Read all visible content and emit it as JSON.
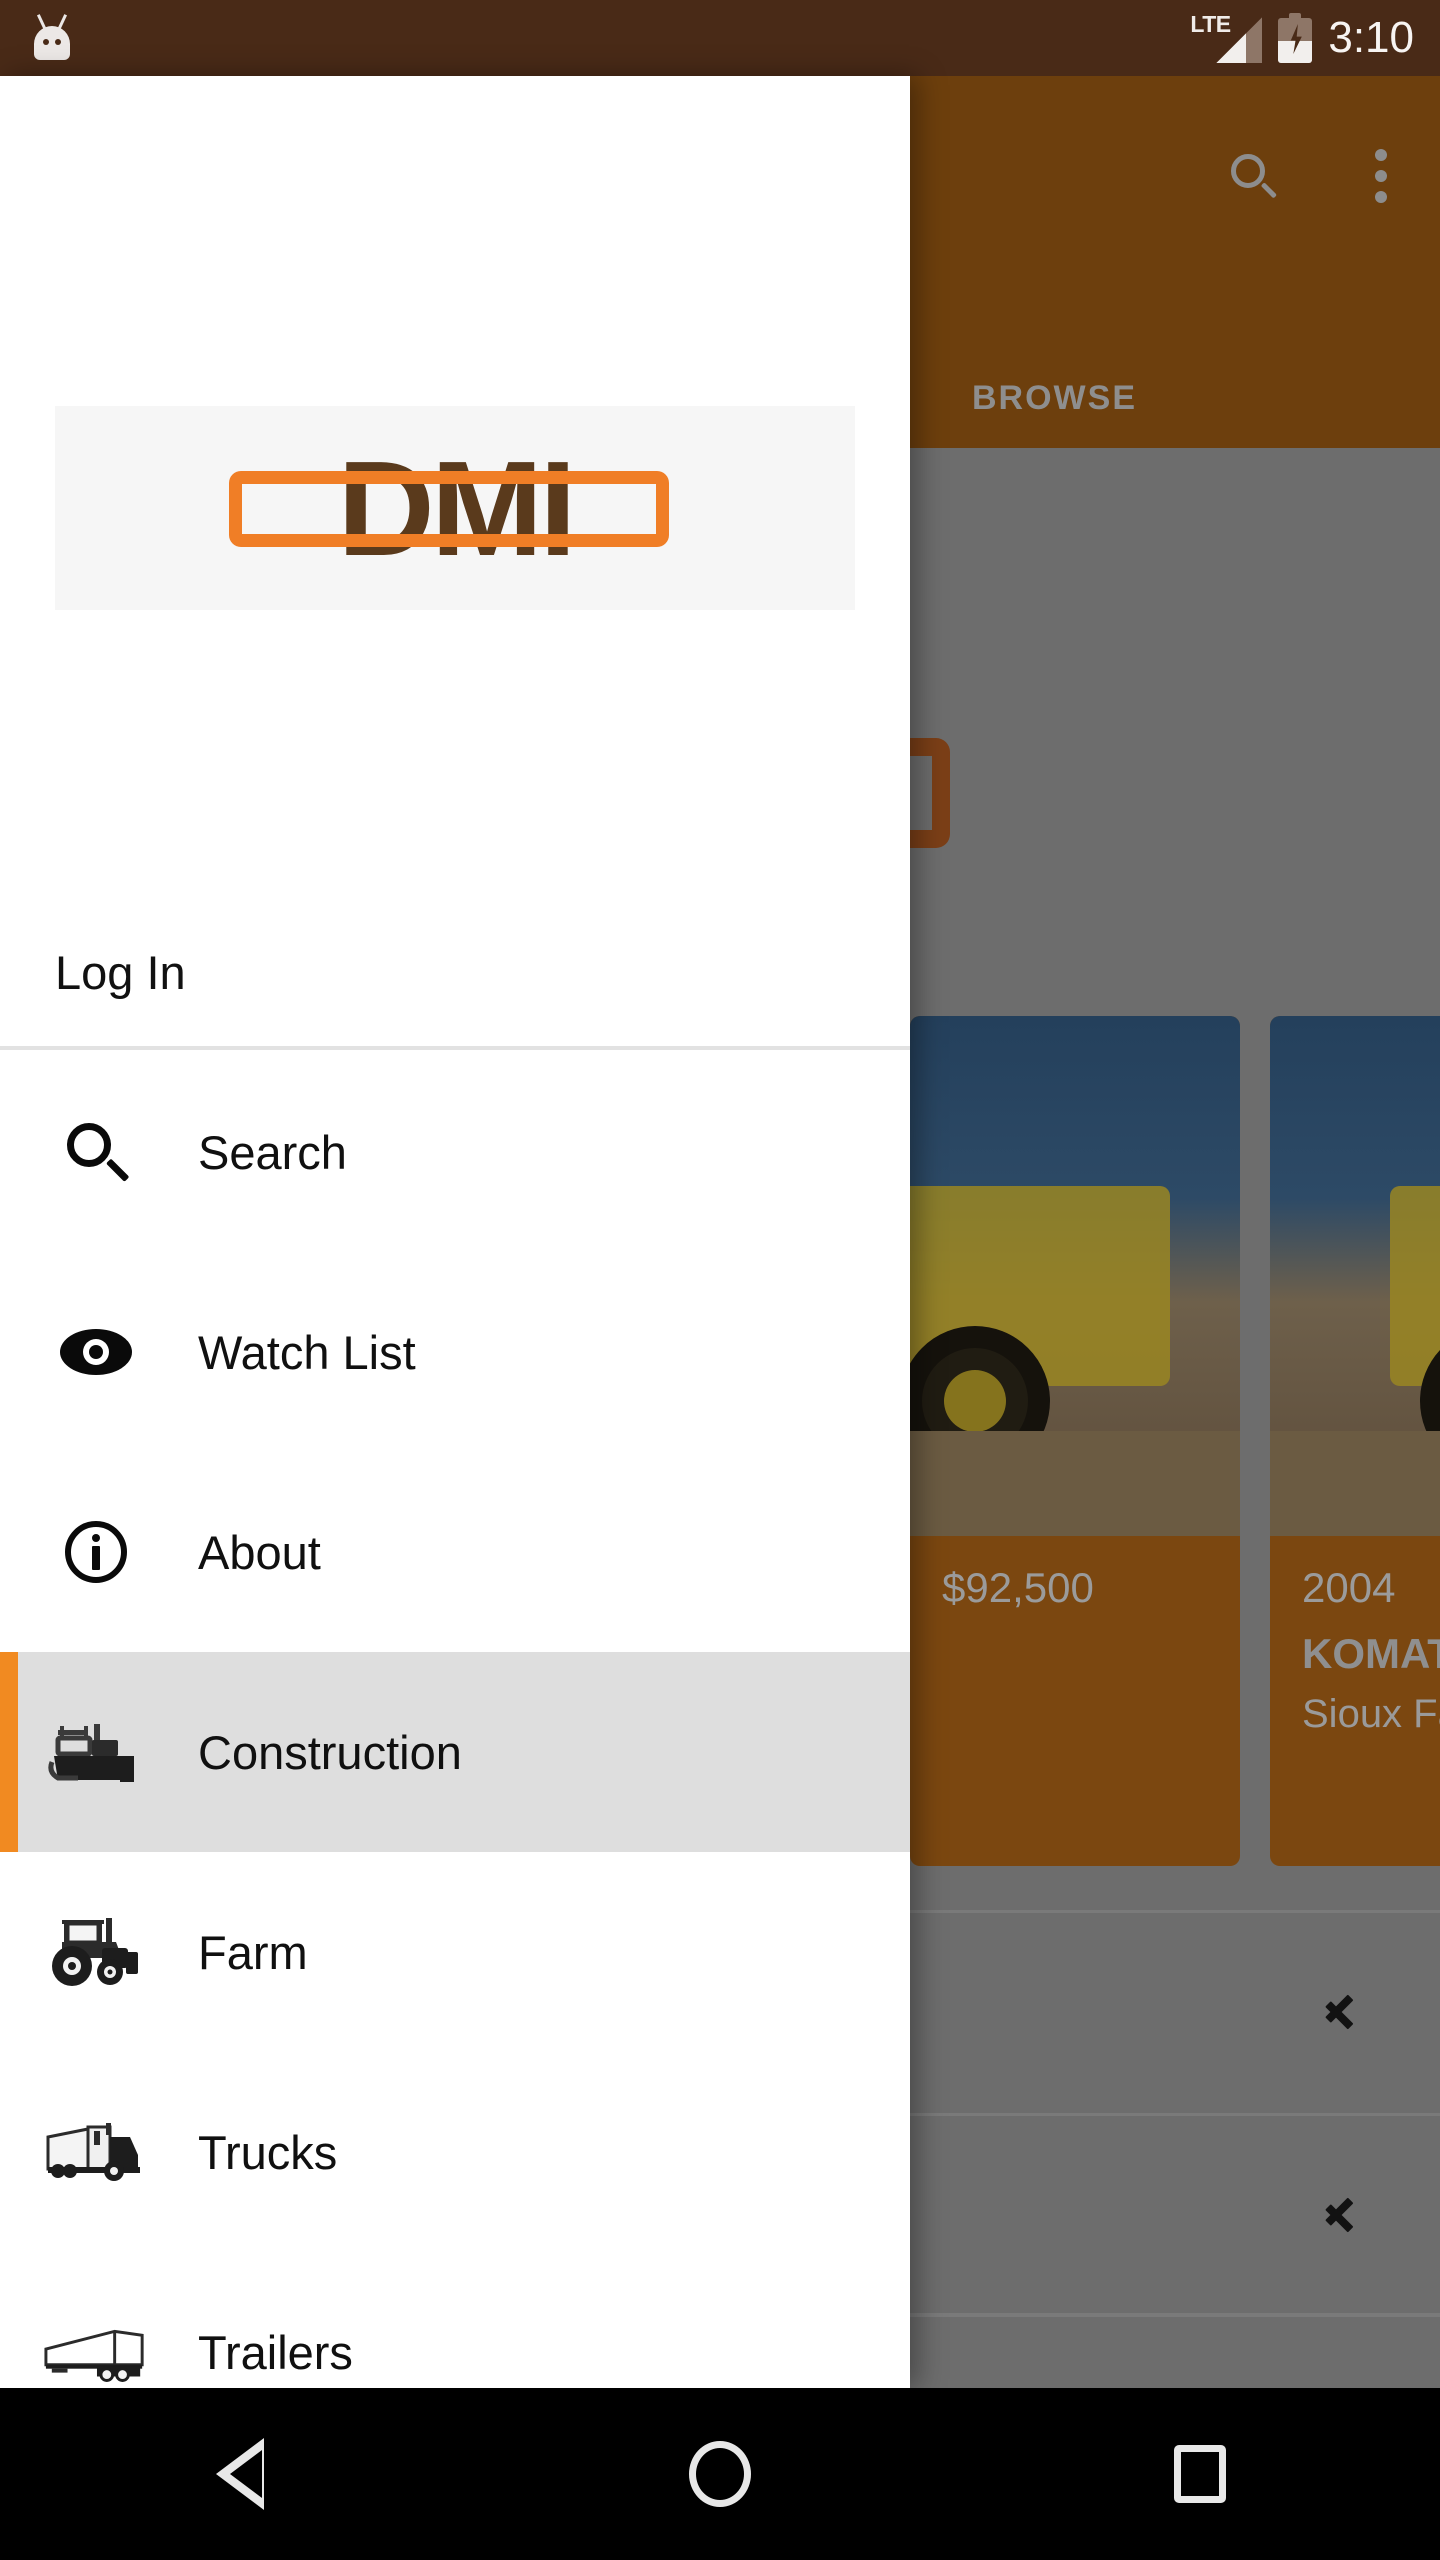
{
  "status_bar": {
    "droid_icon": "android-droid-icon",
    "network_label": "LTE",
    "signal_icon": "signal-bars-icon",
    "battery_icon": "battery-charging-icon",
    "time": "3:10",
    "background_color": "#492a17"
  },
  "background_app": {
    "app_bar": {
      "background_color": "#6d3f0d",
      "search_icon": "search-icon",
      "overflow_icon": "overflow-menu-icon",
      "tab_label": "BROWSE"
    },
    "scrim_color": "#6d6d6d",
    "logo_banner_accent": "#7b3f17",
    "cards": [
      {
        "price": "$92,500",
        "year": "",
        "make": "",
        "location": ""
      },
      {
        "price": "",
        "year": "2004",
        "make": "KOMATSU",
        "location": "Sioux Falls"
      }
    ],
    "list_rows": [
      {
        "chevron_icon": "chevron-right-icon"
      },
      {
        "chevron_icon": "chevron-right-icon"
      }
    ]
  },
  "drawer": {
    "background_color": "#ffffff",
    "logo": {
      "text": "DMI",
      "text_color": "#5a3a1c",
      "accent_color": "#f07e26",
      "banner_color": "#f6f6f6"
    },
    "login": {
      "label": "Log In"
    },
    "items": [
      {
        "label": "Search",
        "icon": "search-icon",
        "selected": false
      },
      {
        "label": "Watch List",
        "icon": "eye-icon",
        "selected": false
      },
      {
        "label": "About",
        "icon": "info-circle-icon",
        "selected": false
      },
      {
        "label": "Construction",
        "icon": "bulldozer-icon",
        "selected": true
      },
      {
        "label": "Farm",
        "icon": "tractor-icon",
        "selected": false
      },
      {
        "label": "Trucks",
        "icon": "semi-truck-icon",
        "selected": false
      },
      {
        "label": "Trailers",
        "icon": "trailer-icon",
        "selected": false
      }
    ],
    "selected_background": "#dedede",
    "selected_accent": "#f18a21"
  },
  "nav_bar": {
    "background_color": "#000000",
    "back_icon": "back-triangle-icon",
    "home_icon": "home-circle-icon",
    "recents_icon": "recents-square-icon"
  }
}
